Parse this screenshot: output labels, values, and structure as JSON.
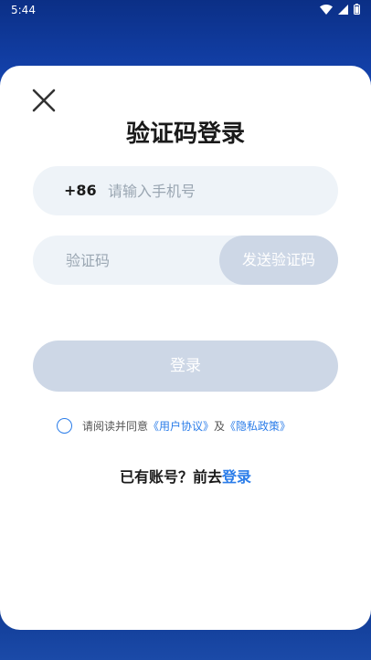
{
  "status_bar": {
    "time": "5:44"
  },
  "title": "验证码登录",
  "phone": {
    "country_code": "+86",
    "placeholder": "请输入手机号"
  },
  "code": {
    "placeholder": "验证码",
    "send_label": "发送验证码"
  },
  "login_button": "登录",
  "agreement": {
    "prefix": "请阅读并同意",
    "user_agreement": "《用户协议》",
    "and": "及",
    "privacy_policy": "《隐私政策》"
  },
  "have_account": {
    "text": "已有账号？前去",
    "login_link": "登录"
  },
  "colors": {
    "accent": "#2b7de9",
    "disabled_button": "#cdd7e6",
    "field_bg": "#eef3f8",
    "background": "#0e3a9c"
  }
}
